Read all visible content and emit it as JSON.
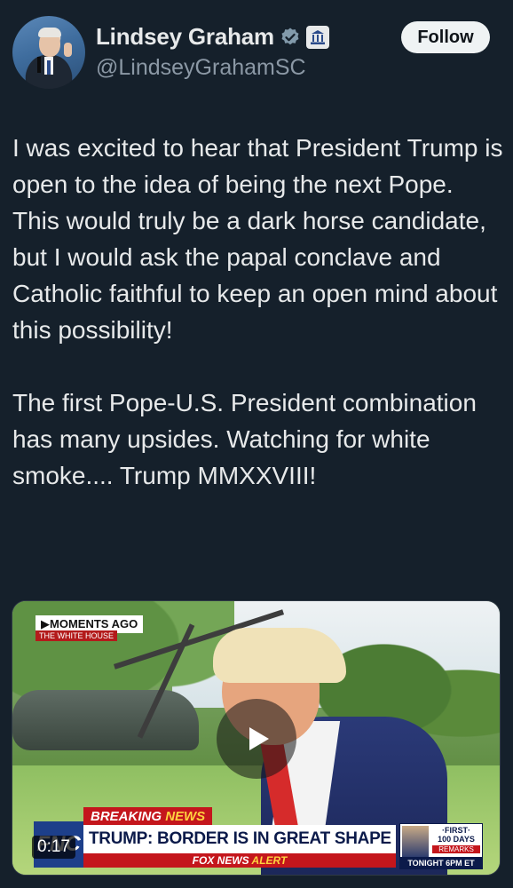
{
  "author": {
    "name": "Lindsey Graham",
    "handle": "@LindseyGrahamSC",
    "verified_icon": "verified-badge-icon",
    "affiliation_icon": "government-building-icon"
  },
  "follow_label": "Follow",
  "tweet": {
    "text": "I was excited to hear that President Trump is open to the idea of being the next Pope. This would truly be a dark horse candidate, but I would ask the papal conclave and Catholic faithful to keep an open mind about this possibility!\n\nThe first Pope-U.S. President combination has many upsides. Watching for white smoke.... Trump MMXXVIII!"
  },
  "video": {
    "duration": "0:17",
    "moments_ago": "▶MOMENTS AGO",
    "location": "THE WHITE HOUSE",
    "breaking": "BREAKING",
    "breaking_news": "NEWS",
    "headline": "TRUMP: BORDER IS IN GREAT SHAPE",
    "alert_prefix": "FOX NEWS",
    "alert_suffix": " ALERT",
    "network_logo": "FNC",
    "promo_line1": "·FIRST·",
    "promo_line2": "100 DAYS",
    "promo_remarks": "REMARKS",
    "promo_time": "TONIGHT 6PM ET"
  },
  "colors": {
    "background": "#15202b",
    "text": "#e7e9ea",
    "secondary_text": "#8b98a5",
    "verified_blue": "#829aab",
    "follow_bg": "#eff3f4"
  }
}
